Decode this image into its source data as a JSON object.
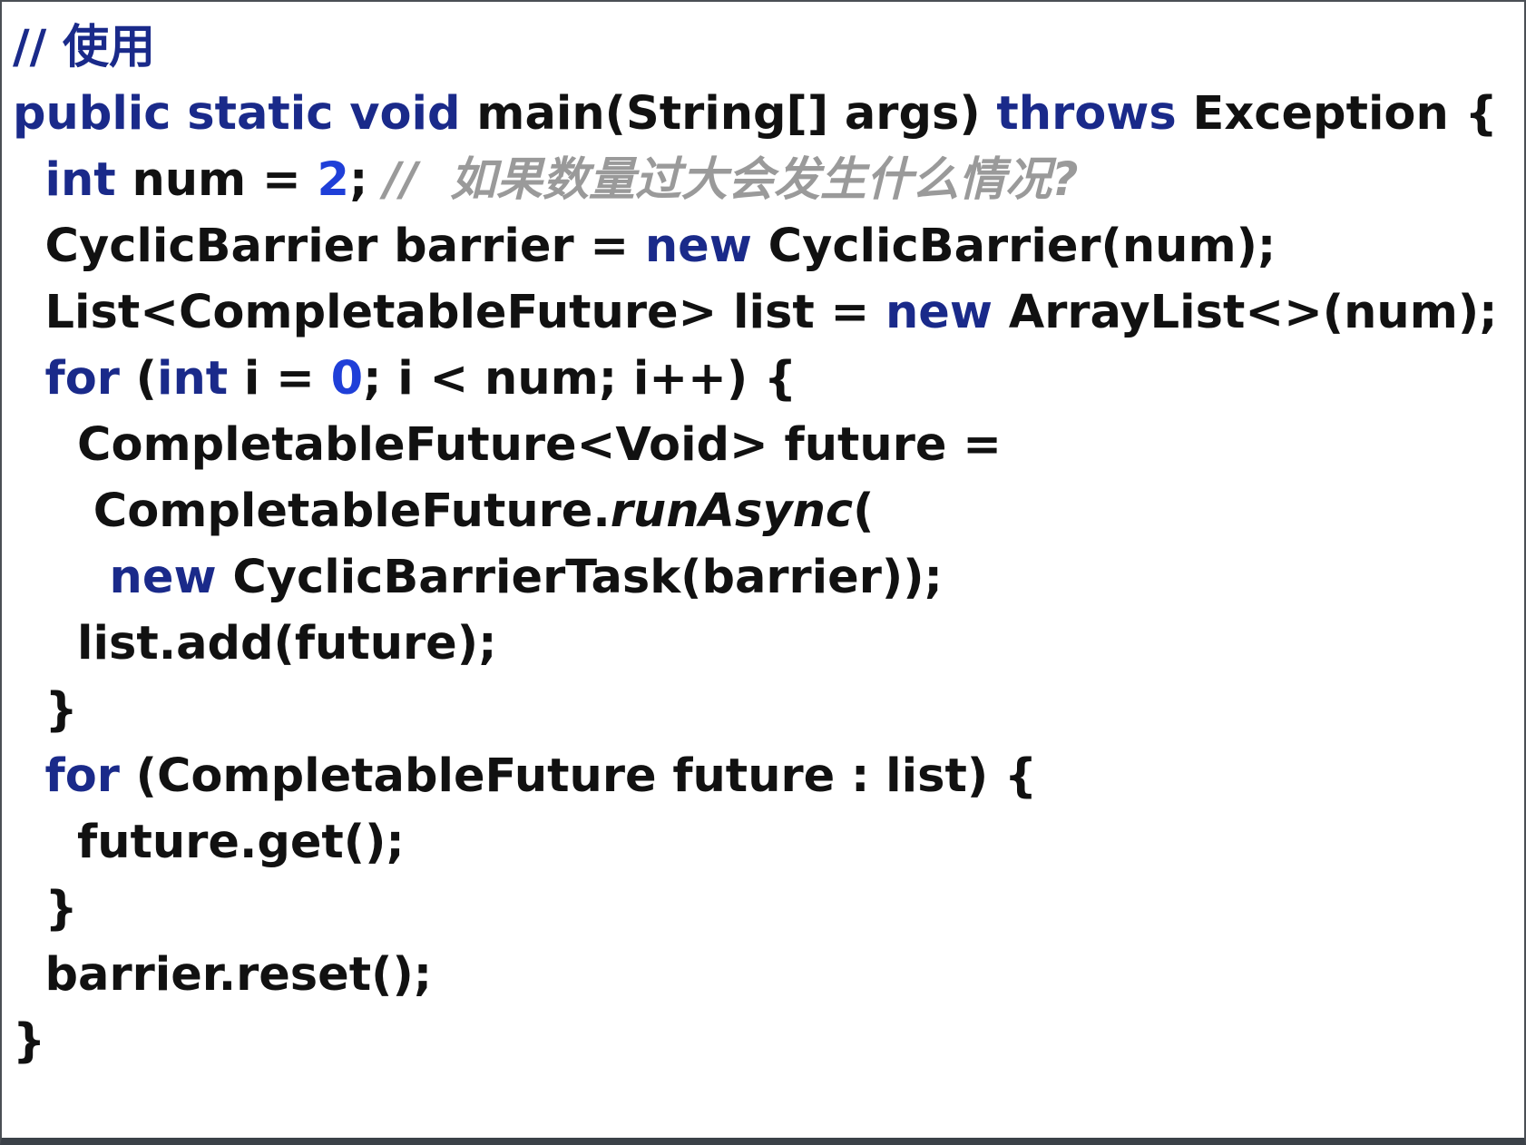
{
  "code": {
    "lines": [
      {
        "indent": "",
        "tokens": [
          {
            "t": "cm-head",
            "v": "// 使用"
          }
        ]
      },
      {
        "indent": "",
        "tokens": [
          {
            "t": "kw",
            "v": "public static void"
          },
          {
            "t": "tx",
            "v": " main(String[] args) "
          },
          {
            "t": "kw",
            "v": "throws"
          },
          {
            "t": "tx",
            "v": " Exception {"
          }
        ]
      },
      {
        "indent": "  ",
        "tokens": [
          {
            "t": "kw",
            "v": "int"
          },
          {
            "t": "tx",
            "v": " num = "
          },
          {
            "t": "num",
            "v": "2"
          },
          {
            "t": "tx",
            "v": "; "
          },
          {
            "t": "cm",
            "v": "//  如果数量过大会发生什么情况?"
          }
        ]
      },
      {
        "indent": "  ",
        "tokens": [
          {
            "t": "tx",
            "v": "CyclicBarrier barrier = "
          },
          {
            "t": "kw",
            "v": "new"
          },
          {
            "t": "tx",
            "v": " CyclicBarrier(num);"
          }
        ]
      },
      {
        "indent": "  ",
        "tokens": [
          {
            "t": "tx",
            "v": "List<CompletableFuture> list = "
          },
          {
            "t": "kw",
            "v": "new"
          },
          {
            "t": "tx",
            "v": " ArrayList<>(num);"
          }
        ]
      },
      {
        "indent": "  ",
        "tokens": [
          {
            "t": "kw",
            "v": "for"
          },
          {
            "t": "tx",
            "v": " ("
          },
          {
            "t": "kw",
            "v": "int"
          },
          {
            "t": "tx",
            "v": " i = "
          },
          {
            "t": "num",
            "v": "0"
          },
          {
            "t": "tx",
            "v": "; i < num; i++) {"
          }
        ]
      },
      {
        "indent": "    ",
        "tokens": [
          {
            "t": "tx",
            "v": "CompletableFuture<Void> future ="
          }
        ]
      },
      {
        "indent": "     ",
        "tokens": [
          {
            "t": "tx",
            "v": "CompletableFuture."
          },
          {
            "t": "it",
            "v": "runAsync"
          },
          {
            "t": "tx",
            "v": "("
          }
        ]
      },
      {
        "indent": "      ",
        "tokens": [
          {
            "t": "kw",
            "v": "new"
          },
          {
            "t": "tx",
            "v": " CyclicBarrierTask(barrier));"
          }
        ]
      },
      {
        "indent": "    ",
        "tokens": [
          {
            "t": "tx",
            "v": "list.add(future);"
          }
        ]
      },
      {
        "indent": "  ",
        "tokens": [
          {
            "t": "tx",
            "v": "}"
          }
        ]
      },
      {
        "indent": "  ",
        "tokens": [
          {
            "t": "kw",
            "v": "for"
          },
          {
            "t": "tx",
            "v": " (CompletableFuture future : list) {"
          }
        ]
      },
      {
        "indent": "    ",
        "tokens": [
          {
            "t": "tx",
            "v": "future.get();"
          }
        ]
      },
      {
        "indent": "  ",
        "tokens": [
          {
            "t": "tx",
            "v": "}"
          }
        ]
      },
      {
        "indent": "  ",
        "tokens": [
          {
            "t": "tx",
            "v": "barrier.reset();"
          }
        ]
      },
      {
        "indent": "",
        "tokens": [
          {
            "t": "tx",
            "v": "}"
          }
        ]
      }
    ]
  },
  "colors": {
    "keyword": "#1a2a8a",
    "number": "#1f3fd8",
    "comment": "#9a9a9a",
    "text": "#111111",
    "background": "#ffffff"
  }
}
